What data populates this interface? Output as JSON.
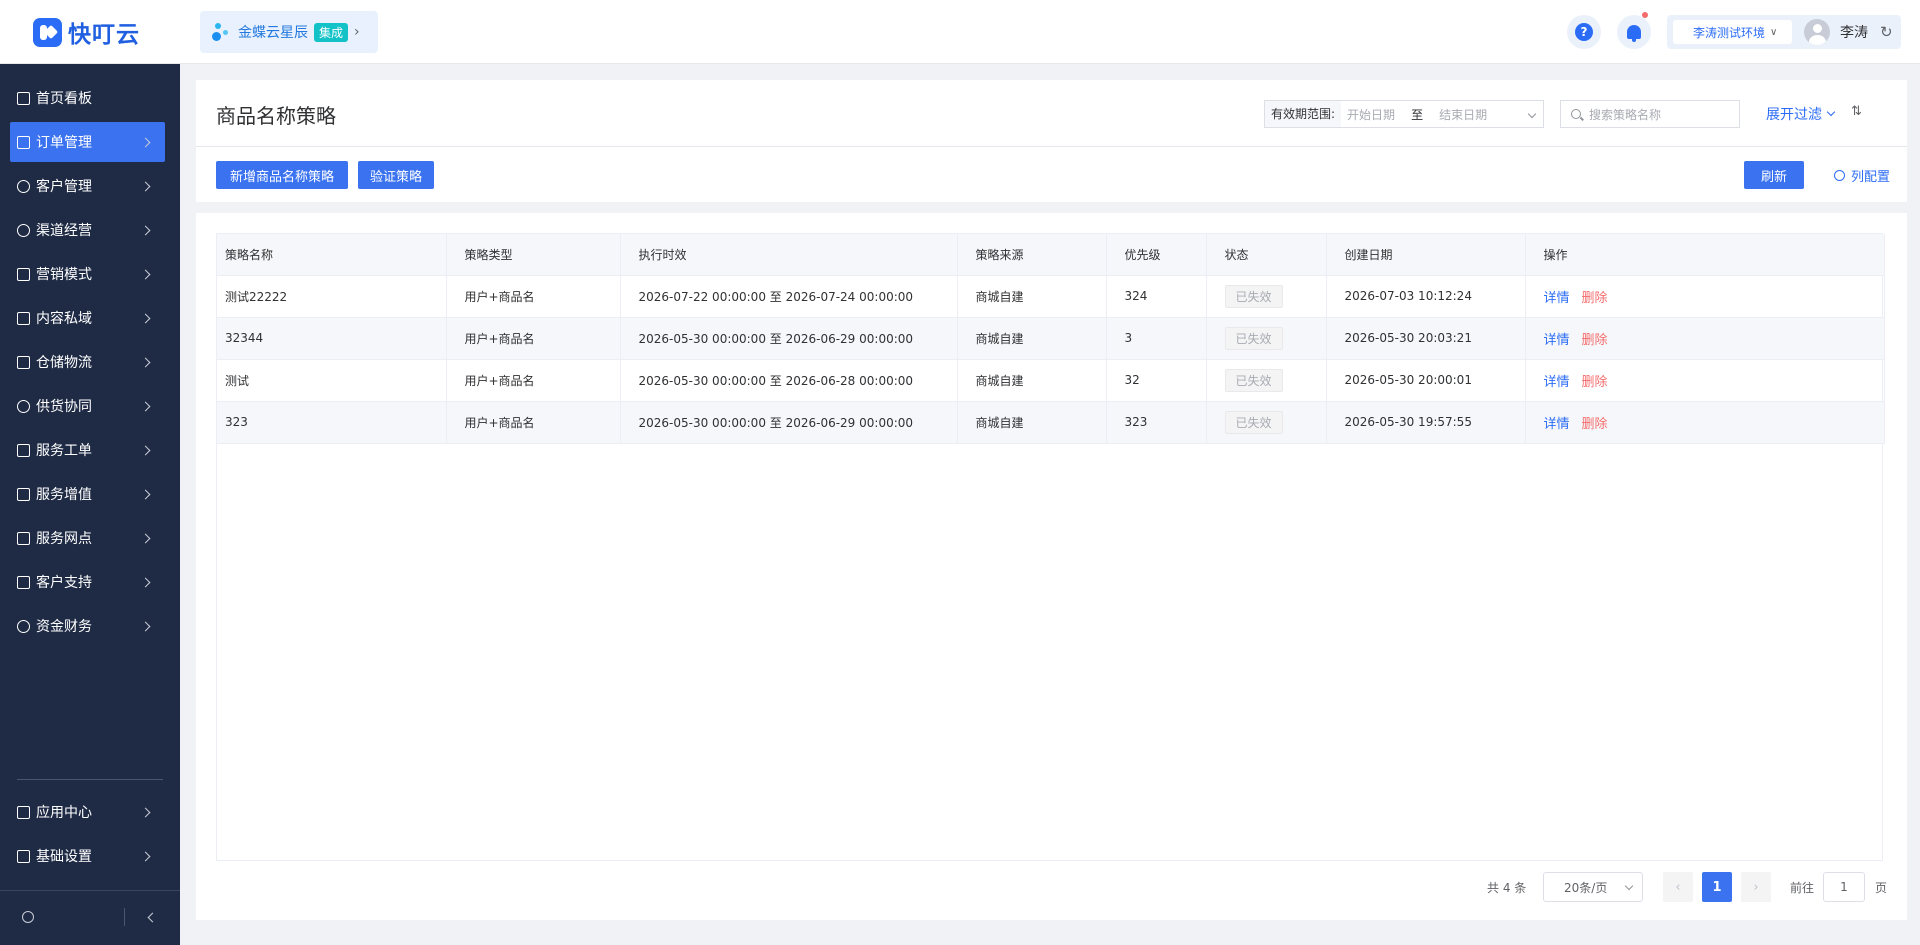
{
  "header": {
    "logo_text": "快叮云",
    "integration_name": "金蝶云星辰",
    "integration_badge": "集成",
    "env_label": "李涛测试环境",
    "username": "李涛",
    "help_glyph": "?"
  },
  "sidebar": {
    "items": [
      {
        "label": "首页看板",
        "icon": "home-icon"
      },
      {
        "label": "订单管理",
        "icon": "order-icon",
        "active": true
      },
      {
        "label": "客户管理",
        "icon": "user-icon"
      },
      {
        "label": "渠道经营",
        "icon": "channel-icon"
      },
      {
        "label": "营销模式",
        "icon": "tag-icon"
      },
      {
        "label": "内容私域",
        "icon": "image-icon"
      },
      {
        "label": "仓储物流",
        "icon": "warehouse-icon"
      },
      {
        "label": "供货协同",
        "icon": "supply-icon"
      },
      {
        "label": "服务工单",
        "icon": "ticket-icon"
      },
      {
        "label": "服务增值",
        "icon": "bag-icon"
      },
      {
        "label": "服务网点",
        "icon": "store-icon"
      },
      {
        "label": "客户支持",
        "icon": "support-icon"
      },
      {
        "label": "资金财务",
        "icon": "yuan-icon"
      }
    ],
    "bottom_items": [
      {
        "label": "应用中心",
        "icon": "cube-icon"
      },
      {
        "label": "基础设置",
        "icon": "settings-list-icon"
      }
    ]
  },
  "page": {
    "title": "商品名称策略",
    "range_label": "有效期范围:",
    "start_placeholder": "开始日期",
    "range_separator": "至",
    "end_placeholder": "结束日期",
    "search_placeholder": "搜索策略名称",
    "expand_filter": "展开过滤",
    "add_button": "新增商品名称策略",
    "verify_button": "验证策略",
    "refresh_button": "刷新",
    "column_config": "列配置"
  },
  "table": {
    "columns": [
      "策略名称",
      "策略类型",
      "执行时效",
      "策略来源",
      "优先级",
      "状态",
      "创建日期",
      "操作"
    ],
    "rows": [
      {
        "name": "测试22222",
        "type": "用户+商品名",
        "period": "2026-07-22 00:00:00 至 2026-07-24 00:00:00",
        "source": "商城自建",
        "priority": "324",
        "status": "已失效",
        "created": "2026-07-03 10:12:24"
      },
      {
        "name": "32344",
        "type": "用户+商品名",
        "period": "2026-05-30 00:00:00 至 2026-06-29 00:00:00",
        "source": "商城自建",
        "priority": "3",
        "status": "已失效",
        "created": "2026-05-30 20:03:21"
      },
      {
        "name": "测试",
        "type": "用户+商品名",
        "period": "2026-05-30 00:00:00 至 2026-06-28 00:00:00",
        "source": "商城自建",
        "priority": "32",
        "status": "已失效",
        "created": "2026-05-30 20:00:01"
      },
      {
        "name": "323",
        "type": "用户+商品名",
        "period": "2026-05-30 00:00:00 至 2026-06-29 00:00:00",
        "source": "商城自建",
        "priority": "323",
        "status": "已失效",
        "created": "2026-05-30 19:57:55"
      }
    ],
    "op_detail": "详情",
    "op_delete": "删除"
  },
  "pagination": {
    "total_text": "共 4 条",
    "page_size": "20条/页",
    "current_page": "1",
    "goto_label": "前往",
    "goto_value": "1",
    "page_suffix": "页"
  },
  "colors": {
    "primary": "#3a72f0",
    "sidebar_bg": "#1f2b45",
    "danger": "#f56c6c"
  }
}
